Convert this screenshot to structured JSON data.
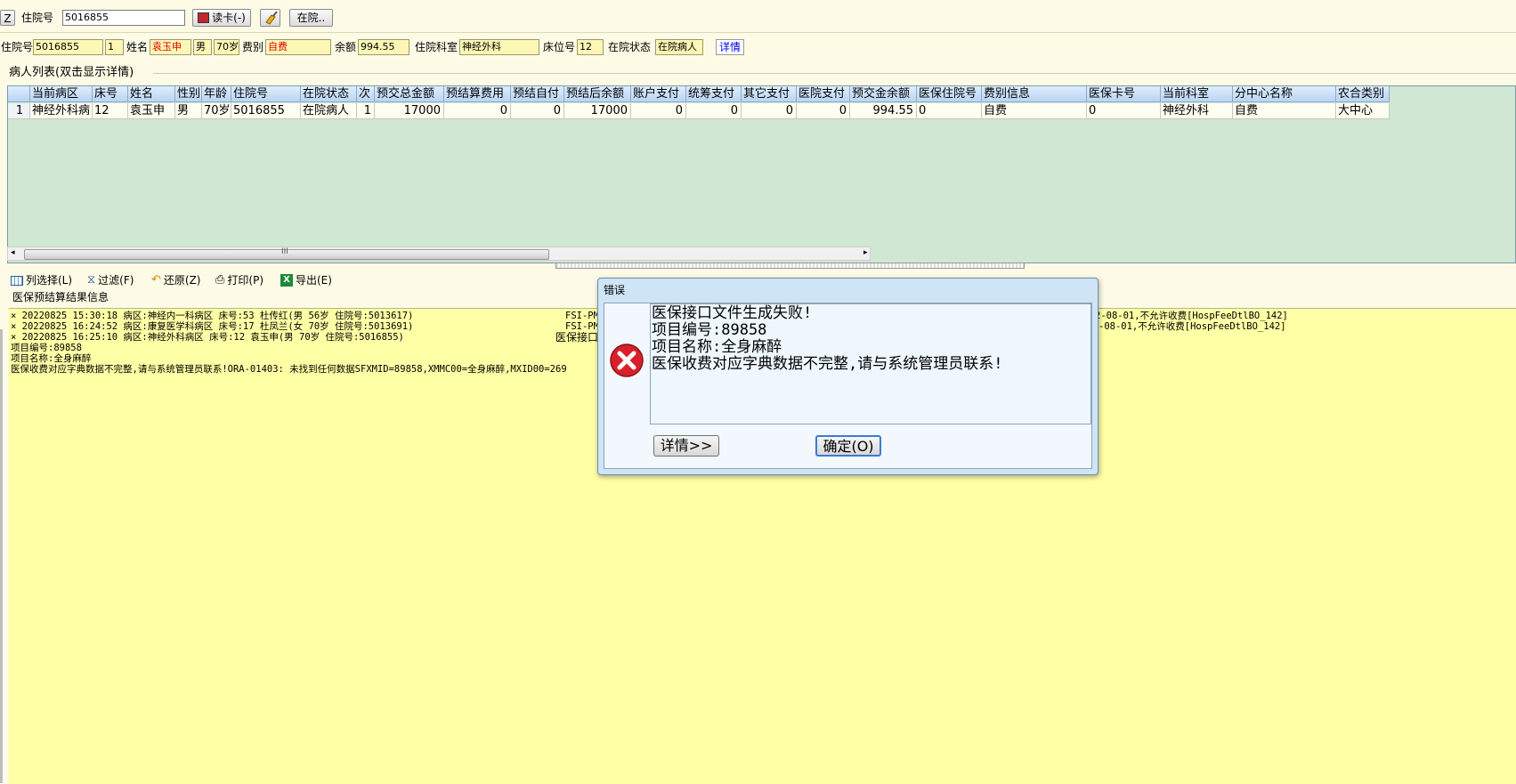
{
  "topbar": {
    "z_button": "Z",
    "admission_label": "住院号",
    "admission_value": "5016855",
    "read_card_button": "读卡(-)",
    "inhosp_button": "在院.."
  },
  "patient_info": {
    "admission_label": "住院号",
    "admission_value": "5016855",
    "times_value": "1",
    "name_label": "姓名",
    "name_value": "袁玉申",
    "gender_value": "男",
    "age_value": "70岁",
    "fee_label": "费别",
    "fee_value": "自费",
    "balance_label": "余额",
    "balance_value": "994.55",
    "dept_label": "住院科室",
    "dept_value": "神经外科",
    "bed_label": "床位号",
    "bed_value": "12",
    "status_label": "在院状态",
    "status_value": "在院病人",
    "detail_link": "详情"
  },
  "patient_list": {
    "title": "病人列表(双击显示详情)",
    "columns": [
      "",
      "当前病区",
      "床号",
      "姓名",
      "性别",
      "年龄",
      "住院号",
      "在院状态",
      "次",
      "预交总金额",
      "预结算费用",
      "预结自付",
      "预结后余额",
      "账户支付",
      "统筹支付",
      "其它支付",
      "医院支付",
      "预交金余额",
      "医保住院号",
      "费别信息",
      "医保卡号",
      "当前科室",
      "分中心名称",
      "农合类别"
    ],
    "rows": [
      [
        "1",
        "神经外科病",
        "12",
        "袁玉申",
        "男",
        "70岁",
        "5016855",
        "在院病人",
        "1",
        "17000",
        "0",
        "0",
        "17000",
        "0",
        "0",
        "0",
        "0",
        "994.55",
        "0",
        "自费",
        "0",
        "神经外科",
        "自费",
        "大中心"
      ]
    ],
    "scroll_grip": "III"
  },
  "toolbar": {
    "column_select": "列选择(L)",
    "filter": "过滤(F)",
    "restore": "还原(Z)",
    "print": "打印(P)",
    "export": "导出(E)"
  },
  "result_section": {
    "title": "医保预结算结果信息",
    "lines": [
      "× 20220825 15:30:18 病区:神经内一科病区 床号:53 杜传红(男 56岁 住院号:5013617)",
      "× 20220825 16:24:52 病区:康复医学科病区 床号:17 杜凤兰(女 70岁 住院号:5013691)",
      "× 20220825 16:25:10 病区:神经外科病区 床号:12 袁玉申(男 70岁 住院号:5016855)",
      "项目编号:89858",
      "项目名称:全身麻醉",
      "医保收费对应字典数据不完整,请与系统管理员联系!ORA-01403: 未找到任何数据SFXMID=89858,XMMC00=全身麻醉,MXID00=269"
    ],
    "mid_fragments": [
      "FSI-PM",
      "FSI-PM",
      "医保接口"
    ],
    "right_fragments": [
      "2-08-01,不允许收费[HospFeeDtlBO_142]",
      "-08-01,不允许收费[HospFeeDtlBO_142]"
    ]
  },
  "dialog": {
    "title": "错误",
    "message": [
      "医保接口文件生成失败!",
      "项目编号:89858",
      "项目名称:全身麻醉",
      "医保收费对应字典数据不完整,请与系统管理员联系!"
    ],
    "details_button": "详情>>",
    "ok_button": "确定(O)",
    "error_icon": "error-x-icon"
  },
  "colors": {
    "background": "#fdfbe6",
    "grid_background": "#cfe7d3",
    "log_background": "#ffffa6",
    "required_text": "#e00000",
    "error_icon": "#d9202a"
  }
}
